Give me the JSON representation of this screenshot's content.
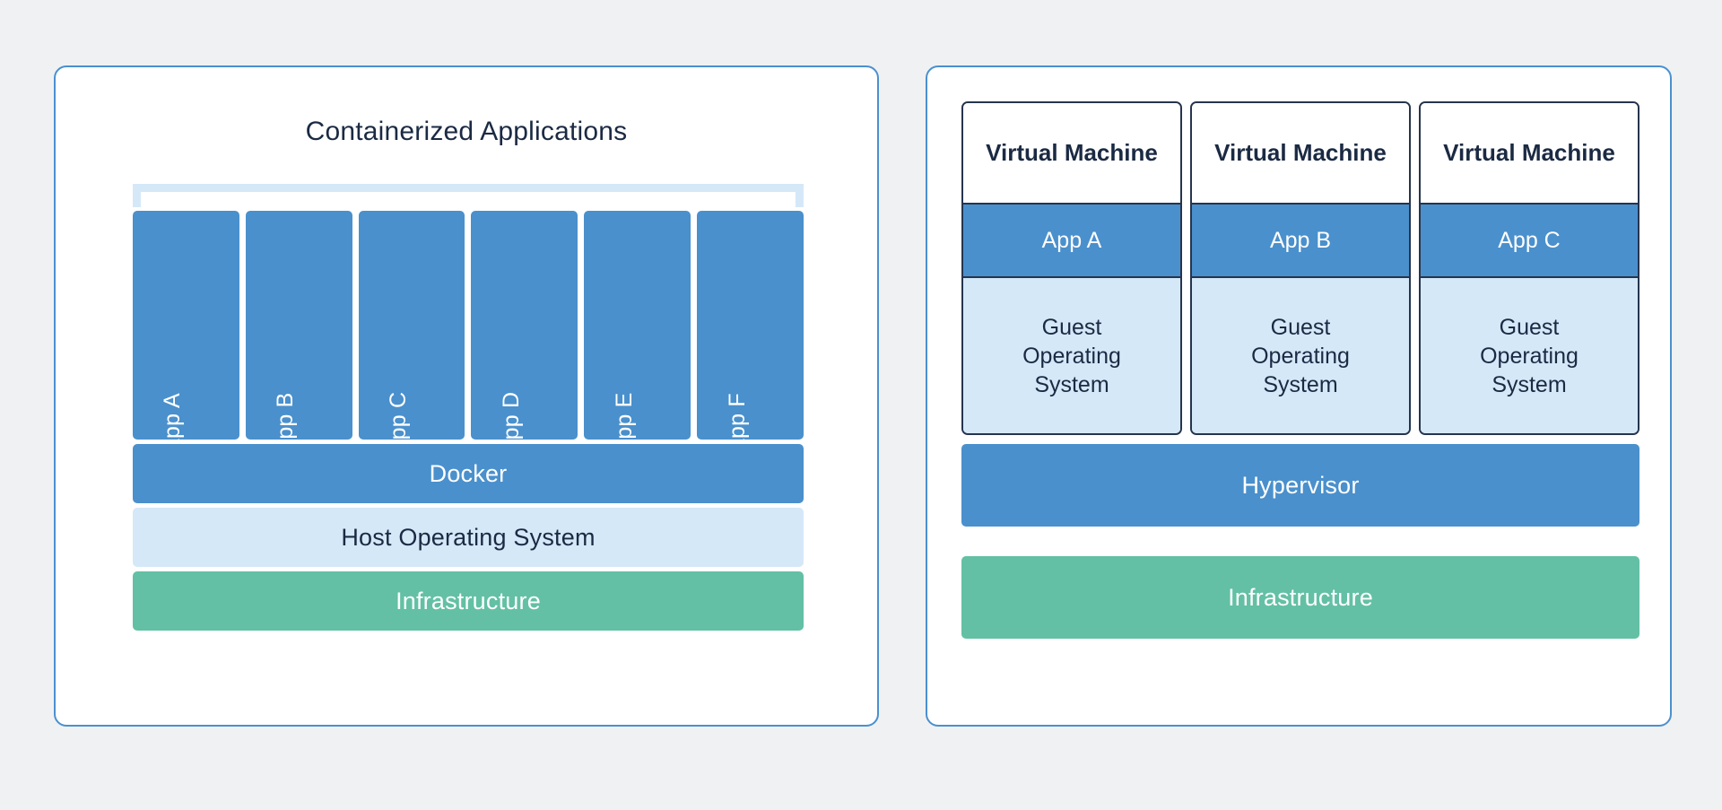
{
  "theme": {
    "page_background": "#f0f1f2",
    "panel_border": "#4a90d0",
    "panel_background": "#ffffff",
    "accent_blue": "#4a90cc",
    "light_blue": "#d5e8f8",
    "green": "#63c0a4",
    "dark_navy": "#1b2a43",
    "vm_border": "#26344d"
  },
  "containers_panel": {
    "title": "Containerized Applications",
    "apps": [
      {
        "label": "App A"
      },
      {
        "label": "App B"
      },
      {
        "label": "App C"
      },
      {
        "label": "App D"
      },
      {
        "label": "App E"
      },
      {
        "label": "App F"
      }
    ],
    "layers": {
      "runtime": "Docker",
      "host_os": "Host Operating System",
      "infrastructure": "Infrastructure"
    }
  },
  "vm_panel": {
    "vms": [
      {
        "title": "Virtual Machine",
        "app": "App A",
        "guest_os_line1": "Guest",
        "guest_os_line2": "Operating",
        "guest_os_line3": "System"
      },
      {
        "title": "Virtual Machine",
        "app": "App B",
        "guest_os_line1": "Guest",
        "guest_os_line2": "Operating",
        "guest_os_line3": "System"
      },
      {
        "title": "Virtual Machine",
        "app": "App C",
        "guest_os_line1": "Guest",
        "guest_os_line2": "Operating",
        "guest_os_line3": "System"
      }
    ],
    "layers": {
      "hypervisor": "Hypervisor",
      "infrastructure": "Infrastructure"
    }
  }
}
